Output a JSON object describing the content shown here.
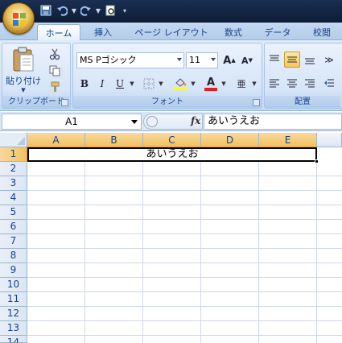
{
  "qat": {
    "items": [
      "save-icon",
      "undo-icon",
      "redo-icon",
      "print-preview-icon",
      "customize-icon"
    ]
  },
  "tabs": [
    "ホーム",
    "挿入",
    "ページ レイアウト",
    "数式",
    "データ",
    "校閲"
  ],
  "clipboard": {
    "paste_label": "貼り付け",
    "group_label": "クリップボード"
  },
  "font": {
    "name": "MS Pゴシック",
    "size": "11",
    "group_label": "フォント"
  },
  "alignment": {
    "group_label": "配置"
  },
  "formula_bar": {
    "name_box": "A1",
    "fx": "fx",
    "content": "あいうえお"
  },
  "grid": {
    "columns": [
      "A",
      "B",
      "C",
      "D",
      "E"
    ],
    "rows": [
      "1",
      "2",
      "3",
      "4",
      "5",
      "6",
      "7",
      "8",
      "9",
      "10",
      "11",
      "12",
      "13",
      "14"
    ],
    "a1_value": "あいうえお"
  },
  "colors": {
    "selected_header": "#f1c15f",
    "ribbon_text": "#15428b",
    "font_color_bar": "#e02020",
    "highlight_bar": "#ffff00"
  }
}
